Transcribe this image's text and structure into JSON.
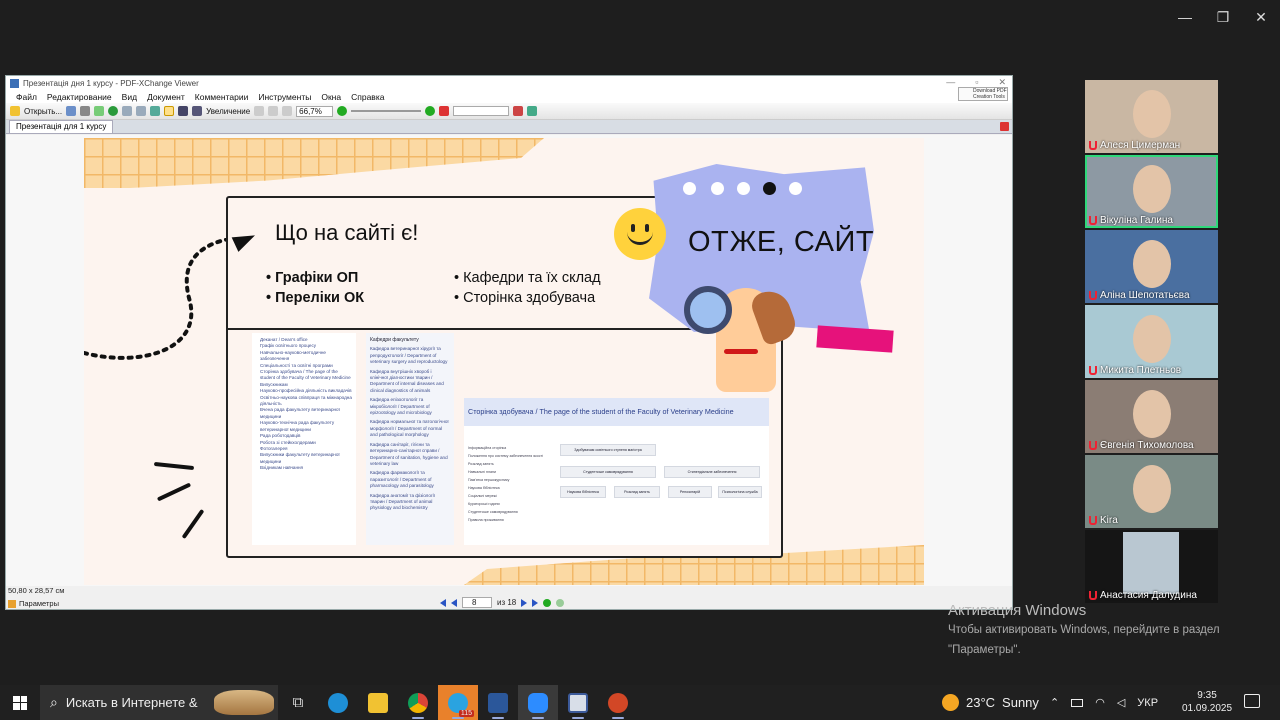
{
  "window_controls": {
    "minimize": "—",
    "maximize": "❐",
    "close": "✕"
  },
  "pdf": {
    "title": "Презентація дня 1 курсу - PDF-XChange Viewer",
    "menu": [
      "Файл",
      "Редактирование",
      "Вид",
      "Документ",
      "Комментарии",
      "Инструменты",
      "Окна",
      "Справка"
    ],
    "download_badge": "Download PDF Creation Tools",
    "toolbar": {
      "open": "Открыть...",
      "zoom_label": "Увеличение",
      "zoom_value": "66,7%"
    },
    "tab": "Презентація для 1 курсу",
    "status": {
      "dims": "50,80 x 28,57 см",
      "params": "Параметры"
    },
    "nav": {
      "page": "8",
      "of": "из 18"
    }
  },
  "slide": {
    "heading": "Що на сайті є!",
    "bullets_left": [
      "Графіки ОП",
      "Переліки ОК"
    ],
    "bullets_right": [
      "Кафедри та їх склад",
      "Сторінка здобувача"
    ],
    "note": "ОТЖЕ, САЙТ",
    "menu_list": [
      "Деканат / Dean's office",
      "Графік освітнього процесу",
      "Навчально-науково-методичне забезпечення",
      "Спеціальності та освітні програми",
      "Сторінка здобувача / The page of the student of the Faculty of Veterinary Medicine",
      "Випускникам",
      "Науково-професійна діяльність викладачів",
      "Освітньо-наукова співпраця та міжнародна діяльність",
      "Вчена рада факультету ветеринарної медицини",
      "Науково-технічна рада факультету ветеринарної медицини",
      "Рада роботодавців",
      "Робота зі стейкхолдерами",
      "Фотогалерея",
      "Випускники факультету ветеринарної медицини",
      "Вхідникам навчання"
    ],
    "dept_header": "Кафедри факультету",
    "dept_list": [
      "Кафедра ветеринарної хірургії та репродуктології / Department of veterinary surgery and reproductology",
      "Кафедра внутрішніх хвороб і клінічної діагностики тварин / Department of internal diseases and clinical diagnostics of animals",
      "Кафедра епізоотології та мікробіології / Department of epizootology and microbiology",
      "Кафедра нормальної та патологічної морфології / Department of normal and pathological morphology",
      "Кафедра санітарії, гігієни та ветеринарно-санітарної справи / Department of sanitation, hygiene and veterinary law",
      "Кафедра фармакології та паразитології / Department of pharmacology and parasitology",
      "Кафедра анатомії та фізіології тварин / Department of animal physiology and biochemistry"
    ],
    "student_banner": "Сторінка здобувача / The page of the student of the Faculty of Veterinary Medicine",
    "student_side": [
      "Інформаційна сторінка",
      "Положення про систему забезпечення якості",
      "Розклад занять",
      "Навчальні плани",
      "Пам'ятка першокурснику",
      "Наукова бібліотека",
      "Соціальні мережі",
      "Кураторські години",
      "Студентське самоврядування",
      "Правила проживання"
    ],
    "student_buttons": [
      "Здобувачам освітнього ступеня магістра",
      "Студентське самоврядування",
      "Стипендіальне забезпечення",
      "Наукова бібліотека",
      "Розклад занять",
      "Репозитарій",
      "Психологічна служба"
    ]
  },
  "participants": [
    {
      "name": "Алеся Цимерман",
      "bg": "#c9b7a3",
      "active": false
    },
    {
      "name": "Вікуліна Галина",
      "bg": "#8d99a3",
      "active": true
    },
    {
      "name": "Аліна Шепотатьєва",
      "bg": "#4a6fa0",
      "active": false
    },
    {
      "name": "Микита Плетньов",
      "bg": "#a9c9d3",
      "active": false
    },
    {
      "name": "Євгенія Тихомолова",
      "bg": "#8b7d74",
      "active": false
    },
    {
      "name": "Kira",
      "bg": "#7a8b86",
      "active": false
    },
    {
      "name": "Анастасия Далудина",
      "bg": "#151515",
      "active": false
    }
  ],
  "activation": {
    "title": "Активация Windows",
    "text1": "Чтобы активировать Windows, перейдите в раздел",
    "text2": "\"Параметры\"."
  },
  "taskbar": {
    "search": "Искать в Интернете &",
    "telegram_badge": "115",
    "weather_temp": "23°C",
    "weather_text": "Sunny",
    "lang": "УКР",
    "time": "9:35",
    "date": "01.09.2025"
  }
}
